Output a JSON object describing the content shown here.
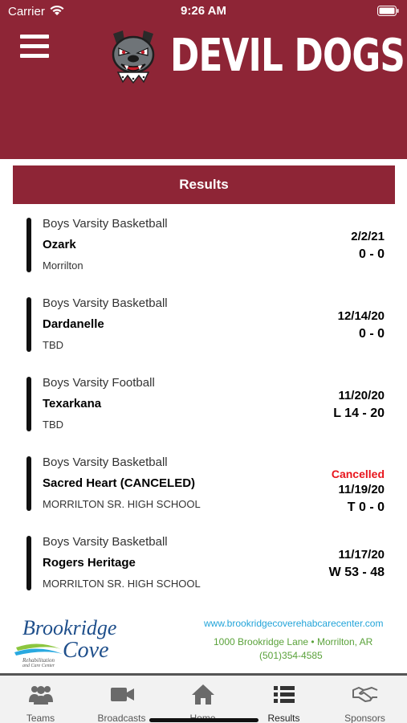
{
  "status_bar": {
    "carrier": "Carrier",
    "time": "9:26 AM"
  },
  "header": {
    "title": "DEVIL DOGS",
    "logo_icon": "bulldog-mascot-icon"
  },
  "section": {
    "title": "Results"
  },
  "games": [
    {
      "sport": "Boys Varsity Basketball",
      "opponent": "Ozark",
      "venue": "Morrilton",
      "status": "",
      "date": "2/2/21",
      "score": "0 - 0"
    },
    {
      "sport": "Boys Varsity Basketball",
      "opponent": "Dardanelle",
      "venue": "TBD",
      "status": "",
      "date": "12/14/20",
      "score": "0 - 0"
    },
    {
      "sport": "Boys Varsity Football",
      "opponent": "Texarkana",
      "venue": "TBD",
      "status": "",
      "date": "11/20/20",
      "score": "L 14 - 20"
    },
    {
      "sport": "Boys Varsity Basketball",
      "opponent": "Sacred Heart (CANCELED)",
      "venue": "MORRILTON SR. HIGH SCHOOL",
      "status": "Cancelled",
      "date": "11/19/20",
      "score": "T 0 - 0"
    },
    {
      "sport": "Boys Varsity Basketball",
      "opponent": "Rogers Heritage",
      "venue": "MORRILTON SR. HIGH SCHOOL",
      "status": "",
      "date": "11/17/20",
      "score": "W 53 - 48"
    }
  ],
  "sponsor": {
    "logo_text": "Brookridge Cove",
    "logo_tagline": "Rehabilitation and Care Center",
    "url": "www.brookridgecoverehabcarecenter.com",
    "address": "1000 Brookridge Lane • Morrilton, AR",
    "phone": "(501)354-4585"
  },
  "tabs": [
    {
      "label": "Teams",
      "icon": "people-icon"
    },
    {
      "label": "Broadcasts",
      "icon": "video-camera-icon"
    },
    {
      "label": "Home",
      "icon": "home-icon"
    },
    {
      "label": "Results",
      "icon": "list-icon"
    },
    {
      "label": "Sponsors",
      "icon": "handshake-icon"
    }
  ],
  "active_tab": "Results",
  "colors": {
    "brand": "#8e2536",
    "cancelled": "#e8141c",
    "sponsor_url": "#23a4d9",
    "sponsor_text": "#5aa23a"
  }
}
